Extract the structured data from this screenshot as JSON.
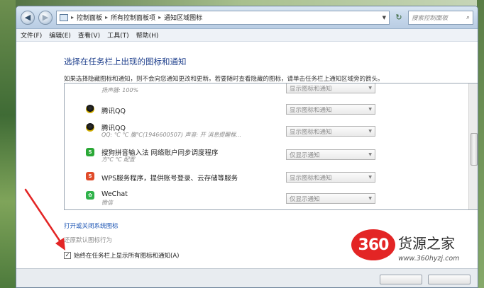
{
  "window": {
    "breadcrumbs": [
      "控制面板",
      "所有控制面板项",
      "通知区域图标"
    ],
    "search_placeholder": "搜索控制面板"
  },
  "menu": [
    "文件(F)",
    "编辑(E)",
    "查看(V)",
    "工具(T)",
    "帮助(H)"
  ],
  "main": {
    "heading": "选择在任务栏上出现的图标和通知",
    "description": "如果选择隐藏图标和通知，则不会向您通知更改和更新。若要随时查看隐藏的图标，请单击任务栏上通知区域旁的箭头。",
    "rows": [
      {
        "icon": "volume-icon",
        "title": "",
        "subtitle": "扬声器: 100%",
        "behavior": "显示图标和通知"
      },
      {
        "icon": "qq-icon",
        "title": "腾讯QQ",
        "subtitle": "",
        "behavior": "显示图标和通知"
      },
      {
        "icon": "qq-icon",
        "title": "腾讯QQ",
        "subtitle": "QQ: ℃ ℃ 腹℃(1946600507) 声音: 开 消息提醒框...",
        "behavior": "显示图标和通知"
      },
      {
        "icon": "sogou-icon",
        "title": "搜狗拼音输入法 网络账户同步调度程序",
        "subtitle": "方℃ ℃ 配置",
        "behavior": "仅显示通知"
      },
      {
        "icon": "wps-icon",
        "title": "WPS服务程序，提供账号登录、云存储等服务",
        "subtitle": "",
        "behavior": "显示图标和通知"
      },
      {
        "icon": "wechat-icon",
        "title": "WeChat",
        "subtitle": "微信",
        "behavior": "仅显示通知"
      }
    ],
    "link_toggle_system_icons": "打开或关闭系统图标",
    "link_restore_defaults": "还原默认图标行为",
    "always_show_label": "始终在任务栏上显示所有图标和通知(A)",
    "always_show_checked": true
  },
  "watermark": {
    "badge": "360",
    "name": "货源之家",
    "url": "www.360hyzj.com"
  },
  "colors": {
    "heading": "#1e3f8c",
    "link": "#1c55b4",
    "annotation": "#e32525"
  }
}
